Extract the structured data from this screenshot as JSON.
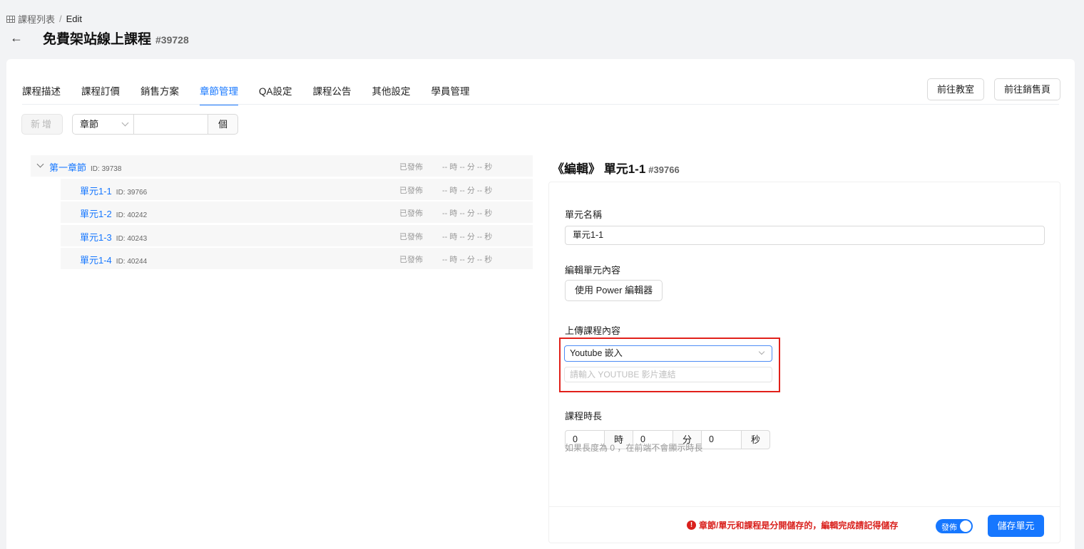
{
  "breadcrumb": {
    "root": "課程列表",
    "separator": "/",
    "current": "Edit"
  },
  "header": {
    "back_icon": "arrow-left-icon",
    "title": "免費架站線上課程",
    "course_id": "#39728"
  },
  "tabs": [
    {
      "label": "課程描述"
    },
    {
      "label": "課程訂價"
    },
    {
      "label": "銷售方案"
    },
    {
      "label": "章節管理",
      "active": true
    },
    {
      "label": "QA設定"
    },
    {
      "label": "課程公告"
    },
    {
      "label": "其他設定"
    },
    {
      "label": "學員管理"
    }
  ],
  "top_actions": {
    "classroom_label": "前往教室",
    "sales_page_label": "前往銷售頁"
  },
  "toolbar": {
    "add_label": "新增",
    "type_select": "章節",
    "count_suffix": "個"
  },
  "tree": {
    "chapter": {
      "label": "第一章節",
      "id_text": "ID: 39738",
      "status": "已發佈",
      "duration": "-- 時 -- 分 -- 秒"
    },
    "units": [
      {
        "label": "單元1-1",
        "id_text": "ID: 39766",
        "status": "已發佈",
        "duration": "-- 時 -- 分 -- 秒"
      },
      {
        "label": "單元1-2",
        "id_text": "ID: 40242",
        "status": "已發佈",
        "duration": "-- 時 -- 分 -- 秒"
      },
      {
        "label": "單元1-3",
        "id_text": "ID: 40243",
        "status": "已發佈",
        "duration": "-- 時 -- 分 -- 秒"
      },
      {
        "label": "單元1-4",
        "id_text": "ID: 40244",
        "status": "已發佈",
        "duration": "-- 時 -- 分 -- 秒"
      }
    ]
  },
  "editor": {
    "heading": "《編輯》 單元1-1",
    "heading_id": "#39766",
    "name_label": "單元名稱",
    "name_value": "單元1-1",
    "content_label": "編輯單元內容",
    "power_editor_label": "使用 Power 編輯器",
    "upload_label": "上傳課程內容",
    "upload_type": "Youtube 嵌入",
    "url_placeholder": "請輸入 YOUTUBE 影片連結",
    "duration_label": "課程時長",
    "hours": "0",
    "hours_unit": "時",
    "minutes": "0",
    "minutes_unit": "分",
    "seconds": "0",
    "seconds_unit": "秒",
    "duration_hint": "如果長度為 0 ，在前端不會顯示時長"
  },
  "footer": {
    "warning": "章節/單元和課程是分開儲存的，編輯完成請記得儲存",
    "publish_toggle_label": "發佈",
    "publish_on": true,
    "save_label": "儲存單元"
  },
  "colors": {
    "accent": "#1677ff",
    "warning": "#d9201c",
    "highlight": "#e1201a"
  }
}
